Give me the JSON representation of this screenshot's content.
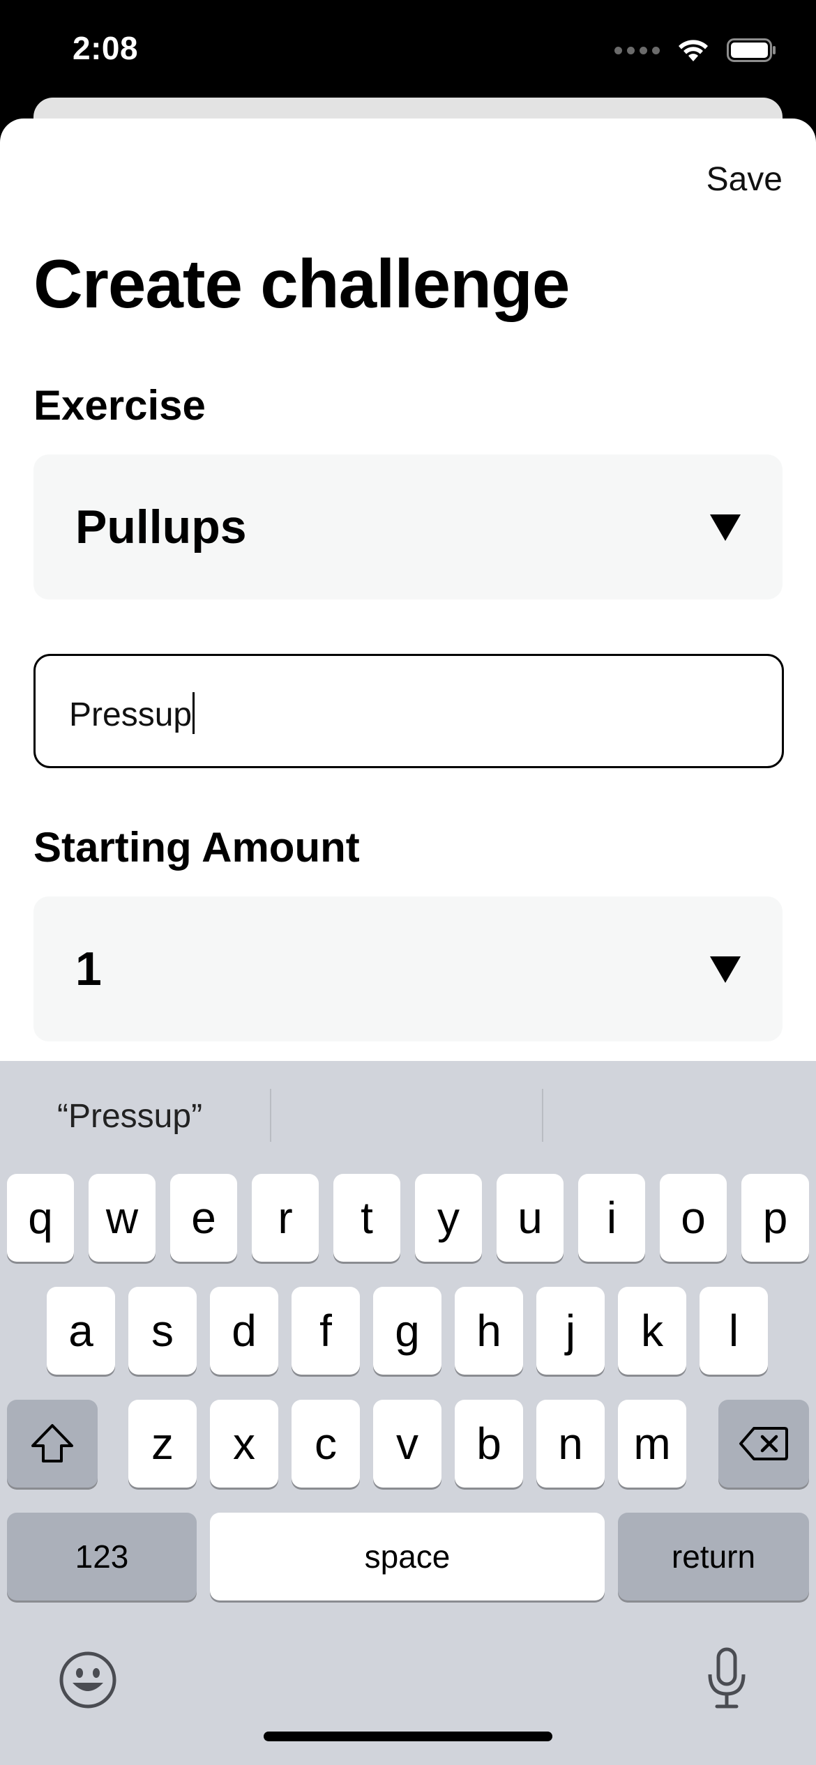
{
  "status_bar": {
    "time": "2:08"
  },
  "header": {
    "save_label": "Save"
  },
  "title": "Create challenge",
  "exercise": {
    "label": "Exercise",
    "selected": "Pullups"
  },
  "custom_exercise_input": {
    "value": "Pressup"
  },
  "starting_amount": {
    "label": "Starting Amount",
    "selected": "1"
  },
  "keyboard": {
    "suggestion": "“Pressup”",
    "row1": [
      "q",
      "w",
      "e",
      "r",
      "t",
      "y",
      "u",
      "i",
      "o",
      "p"
    ],
    "row2": [
      "a",
      "s",
      "d",
      "f",
      "g",
      "h",
      "j",
      "k",
      "l"
    ],
    "row3": [
      "z",
      "x",
      "c",
      "v",
      "b",
      "n",
      "m"
    ],
    "numbers_label": "123",
    "space_label": "space",
    "return_label": "return"
  },
  "icons": [
    "wifi-icon",
    "battery-icon",
    "dropdown-arrow-icon",
    "shift-icon",
    "backspace-icon",
    "emoji-icon",
    "microphone-icon"
  ]
}
